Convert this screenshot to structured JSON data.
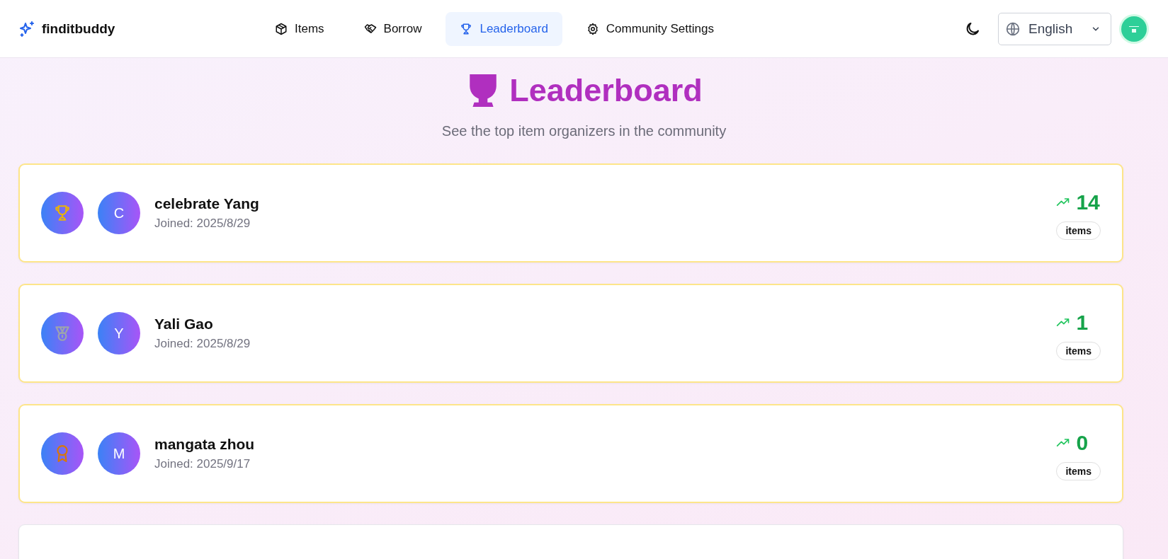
{
  "brand": {
    "name": "finditbuddy"
  },
  "nav": [
    {
      "label": "Items",
      "selected": false
    },
    {
      "label": "Borrow",
      "selected": false
    },
    {
      "label": "Leaderboard",
      "selected": true
    },
    {
      "label": "Community Settings",
      "selected": false
    }
  ],
  "language": {
    "value": "English"
  },
  "page": {
    "title": "Leaderboard",
    "subtitle": "See the top item organizers in the community"
  },
  "leaders": [
    {
      "initial": "C",
      "name": "celebrate Yang",
      "joined": "Joined: 2025/8/29",
      "count": "14",
      "unit": "items"
    },
    {
      "initial": "Y",
      "name": "Yali Gao",
      "joined": "Joined: 2025/8/29",
      "count": "1",
      "unit": "items"
    },
    {
      "initial": "M",
      "name": "mangata zhou",
      "joined": "Joined: 2025/9/17",
      "count": "0",
      "unit": "items"
    }
  ]
}
